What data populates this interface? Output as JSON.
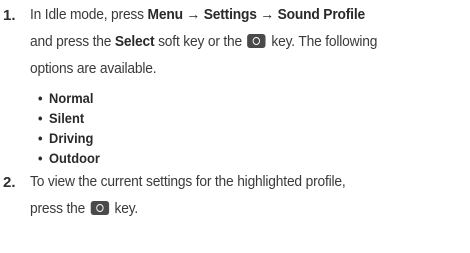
{
  "steps": [
    {
      "number": "1.",
      "text_a": "In Idle mode, press ",
      "menu": "Menu",
      "arrow1": " → ",
      "settings": "Settings",
      "arrow2": " → ",
      "sound_profile": "Sound Profile",
      "text_b": "and press the ",
      "select": "Select",
      "text_c": " soft key or the ",
      "key_icon": "ok-key-icon",
      "text_d": " key. The following",
      "text_e": "options are available."
    },
    {
      "number": "2.",
      "text_a": "To view the current settings for the highlighted profile,",
      "text_b": "press the ",
      "key_icon": "ok-key-icon",
      "text_c": " key."
    }
  ],
  "options": {
    "bullet": "•",
    "items": [
      "Normal",
      "Silent",
      "Driving",
      "Outdoor"
    ]
  }
}
